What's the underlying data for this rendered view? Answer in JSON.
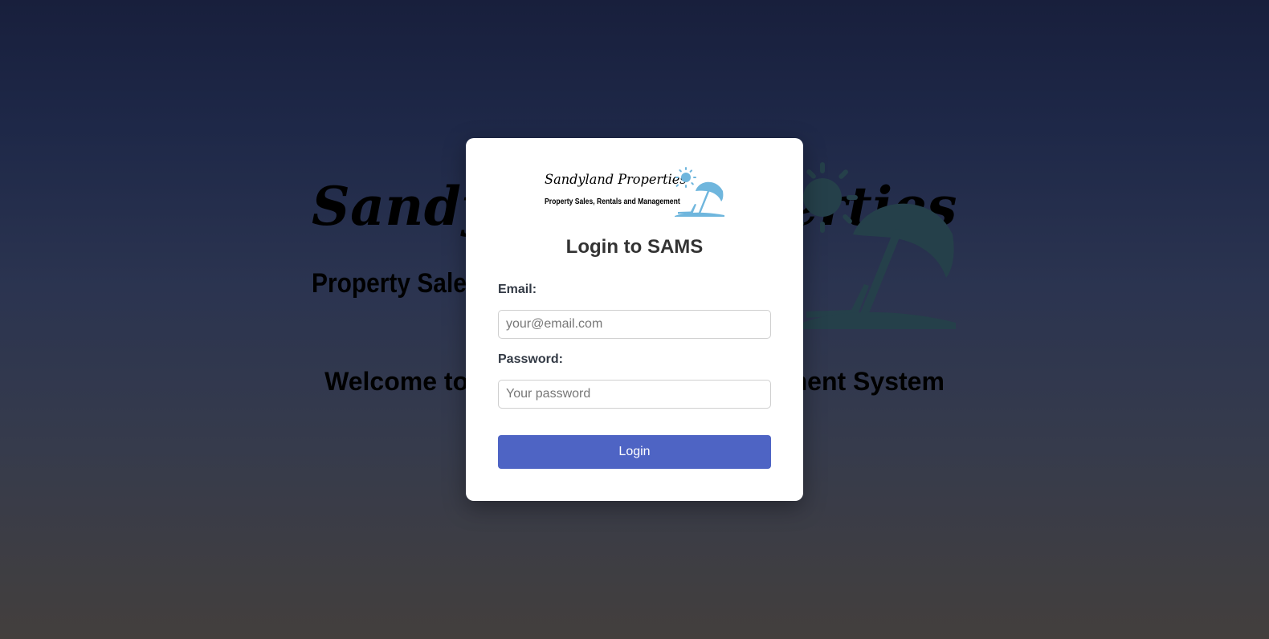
{
  "background": {
    "logo_title": "Sandyland Properties",
    "logo_subtitle": "Property Sales, Rentals and Management",
    "welcome_text": "Welcome to Sandyland Asset Management System"
  },
  "modal": {
    "logo": {
      "title": "Sandyland Properties",
      "subtitle": "Property Sales, Rentals and Management",
      "art_icon": "sun-umbrella-beach-icon"
    },
    "title": "Login to SAMS",
    "email": {
      "label": "Email:",
      "placeholder": "your@email.com",
      "value": ""
    },
    "password": {
      "label": "Password:",
      "placeholder": "Your password",
      "value": ""
    },
    "login_button_label": "Login"
  },
  "colors": {
    "accent_button": "#4e64c4",
    "logo_blue": "#6fb6dd",
    "background_top": "#181f3c",
    "background_bottom": "#433f3d"
  }
}
